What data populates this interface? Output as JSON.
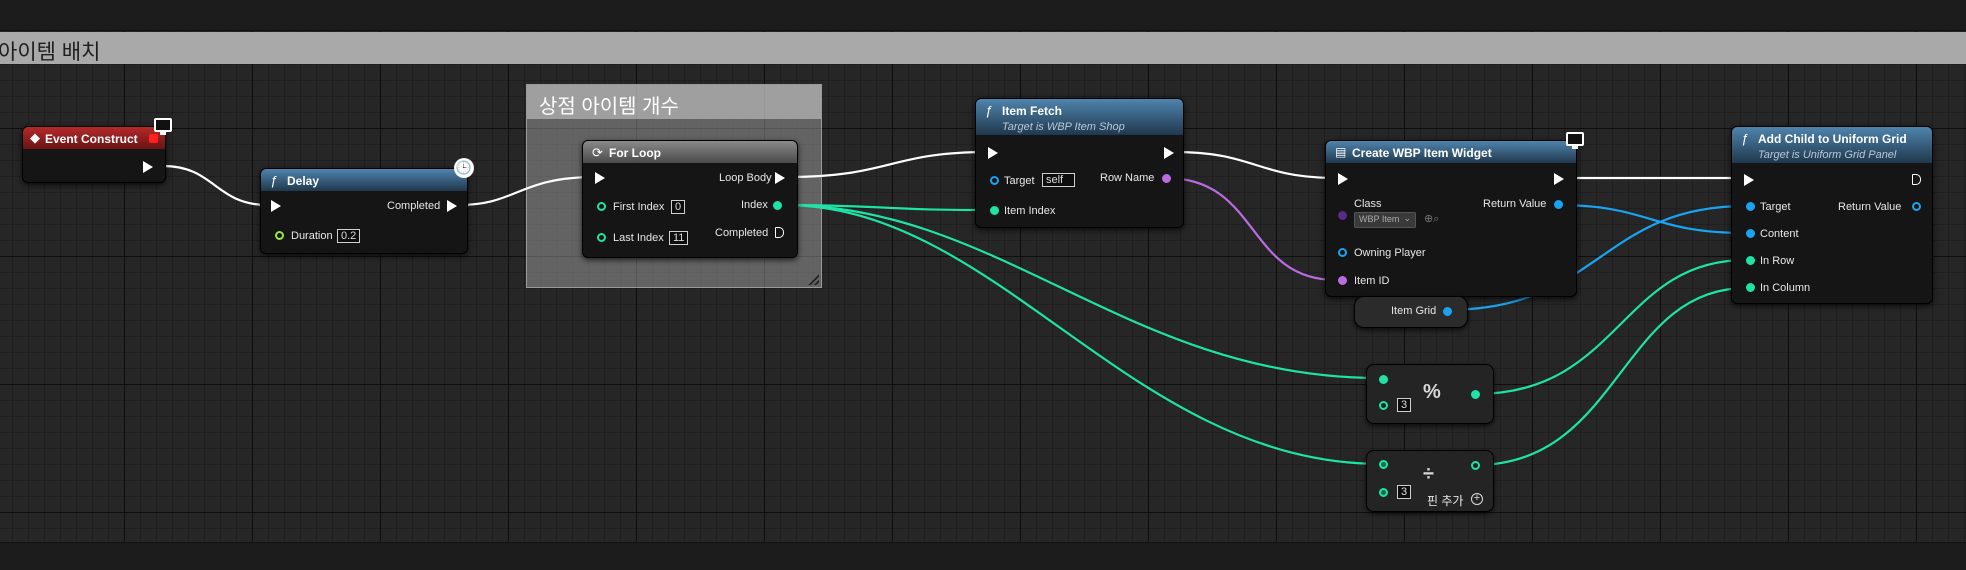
{
  "comment_banner": "아이템 배치",
  "comment_box_title": "상점 아이템 개수",
  "colors": {
    "exec": "#ffffff",
    "integer": "#1ee3a4",
    "name": "#b96ce0",
    "object": "#1aa3f0",
    "float": "#9ae63c",
    "event": "#b52a2a",
    "function": "#3f6f98"
  },
  "event_construct": {
    "title": "Event Construct",
    "icon": "diamond-icon"
  },
  "delay": {
    "title": "Delay",
    "completed": "Completed",
    "duration_label": "Duration",
    "duration_value": "0.2",
    "icon": "clock-icon"
  },
  "for_loop": {
    "title": "For Loop",
    "loop_body": "Loop Body",
    "first_index": "First Index",
    "first_index_value": "0",
    "index": "Index",
    "last_index": "Last Index",
    "last_index_value": "11",
    "completed": "Completed"
  },
  "item_fetch": {
    "title": "Item Fetch",
    "subtitle": "Target is WBP Item Shop",
    "target": "Target",
    "target_value": "self",
    "row_name": "Row Name",
    "item_index": "Item Index"
  },
  "create_widget": {
    "title": "Create WBP Item Widget",
    "class": "Class",
    "class_value": "WBP Item",
    "return_value": "Return Value",
    "owning_player": "Owning Player",
    "item_id": "Item ID"
  },
  "item_grid": {
    "label": "Item Grid"
  },
  "add_child": {
    "title": "Add Child to Uniform Grid",
    "subtitle": "Target is Uniform Grid Panel",
    "target": "Target",
    "return_value": "Return Value",
    "content": "Content",
    "in_row": "In Row",
    "in_column": "In Column"
  },
  "modulo": {
    "symbol": "%",
    "value": "3"
  },
  "divide": {
    "symbol": "÷",
    "value": "3",
    "add_pin": "핀 추가"
  }
}
